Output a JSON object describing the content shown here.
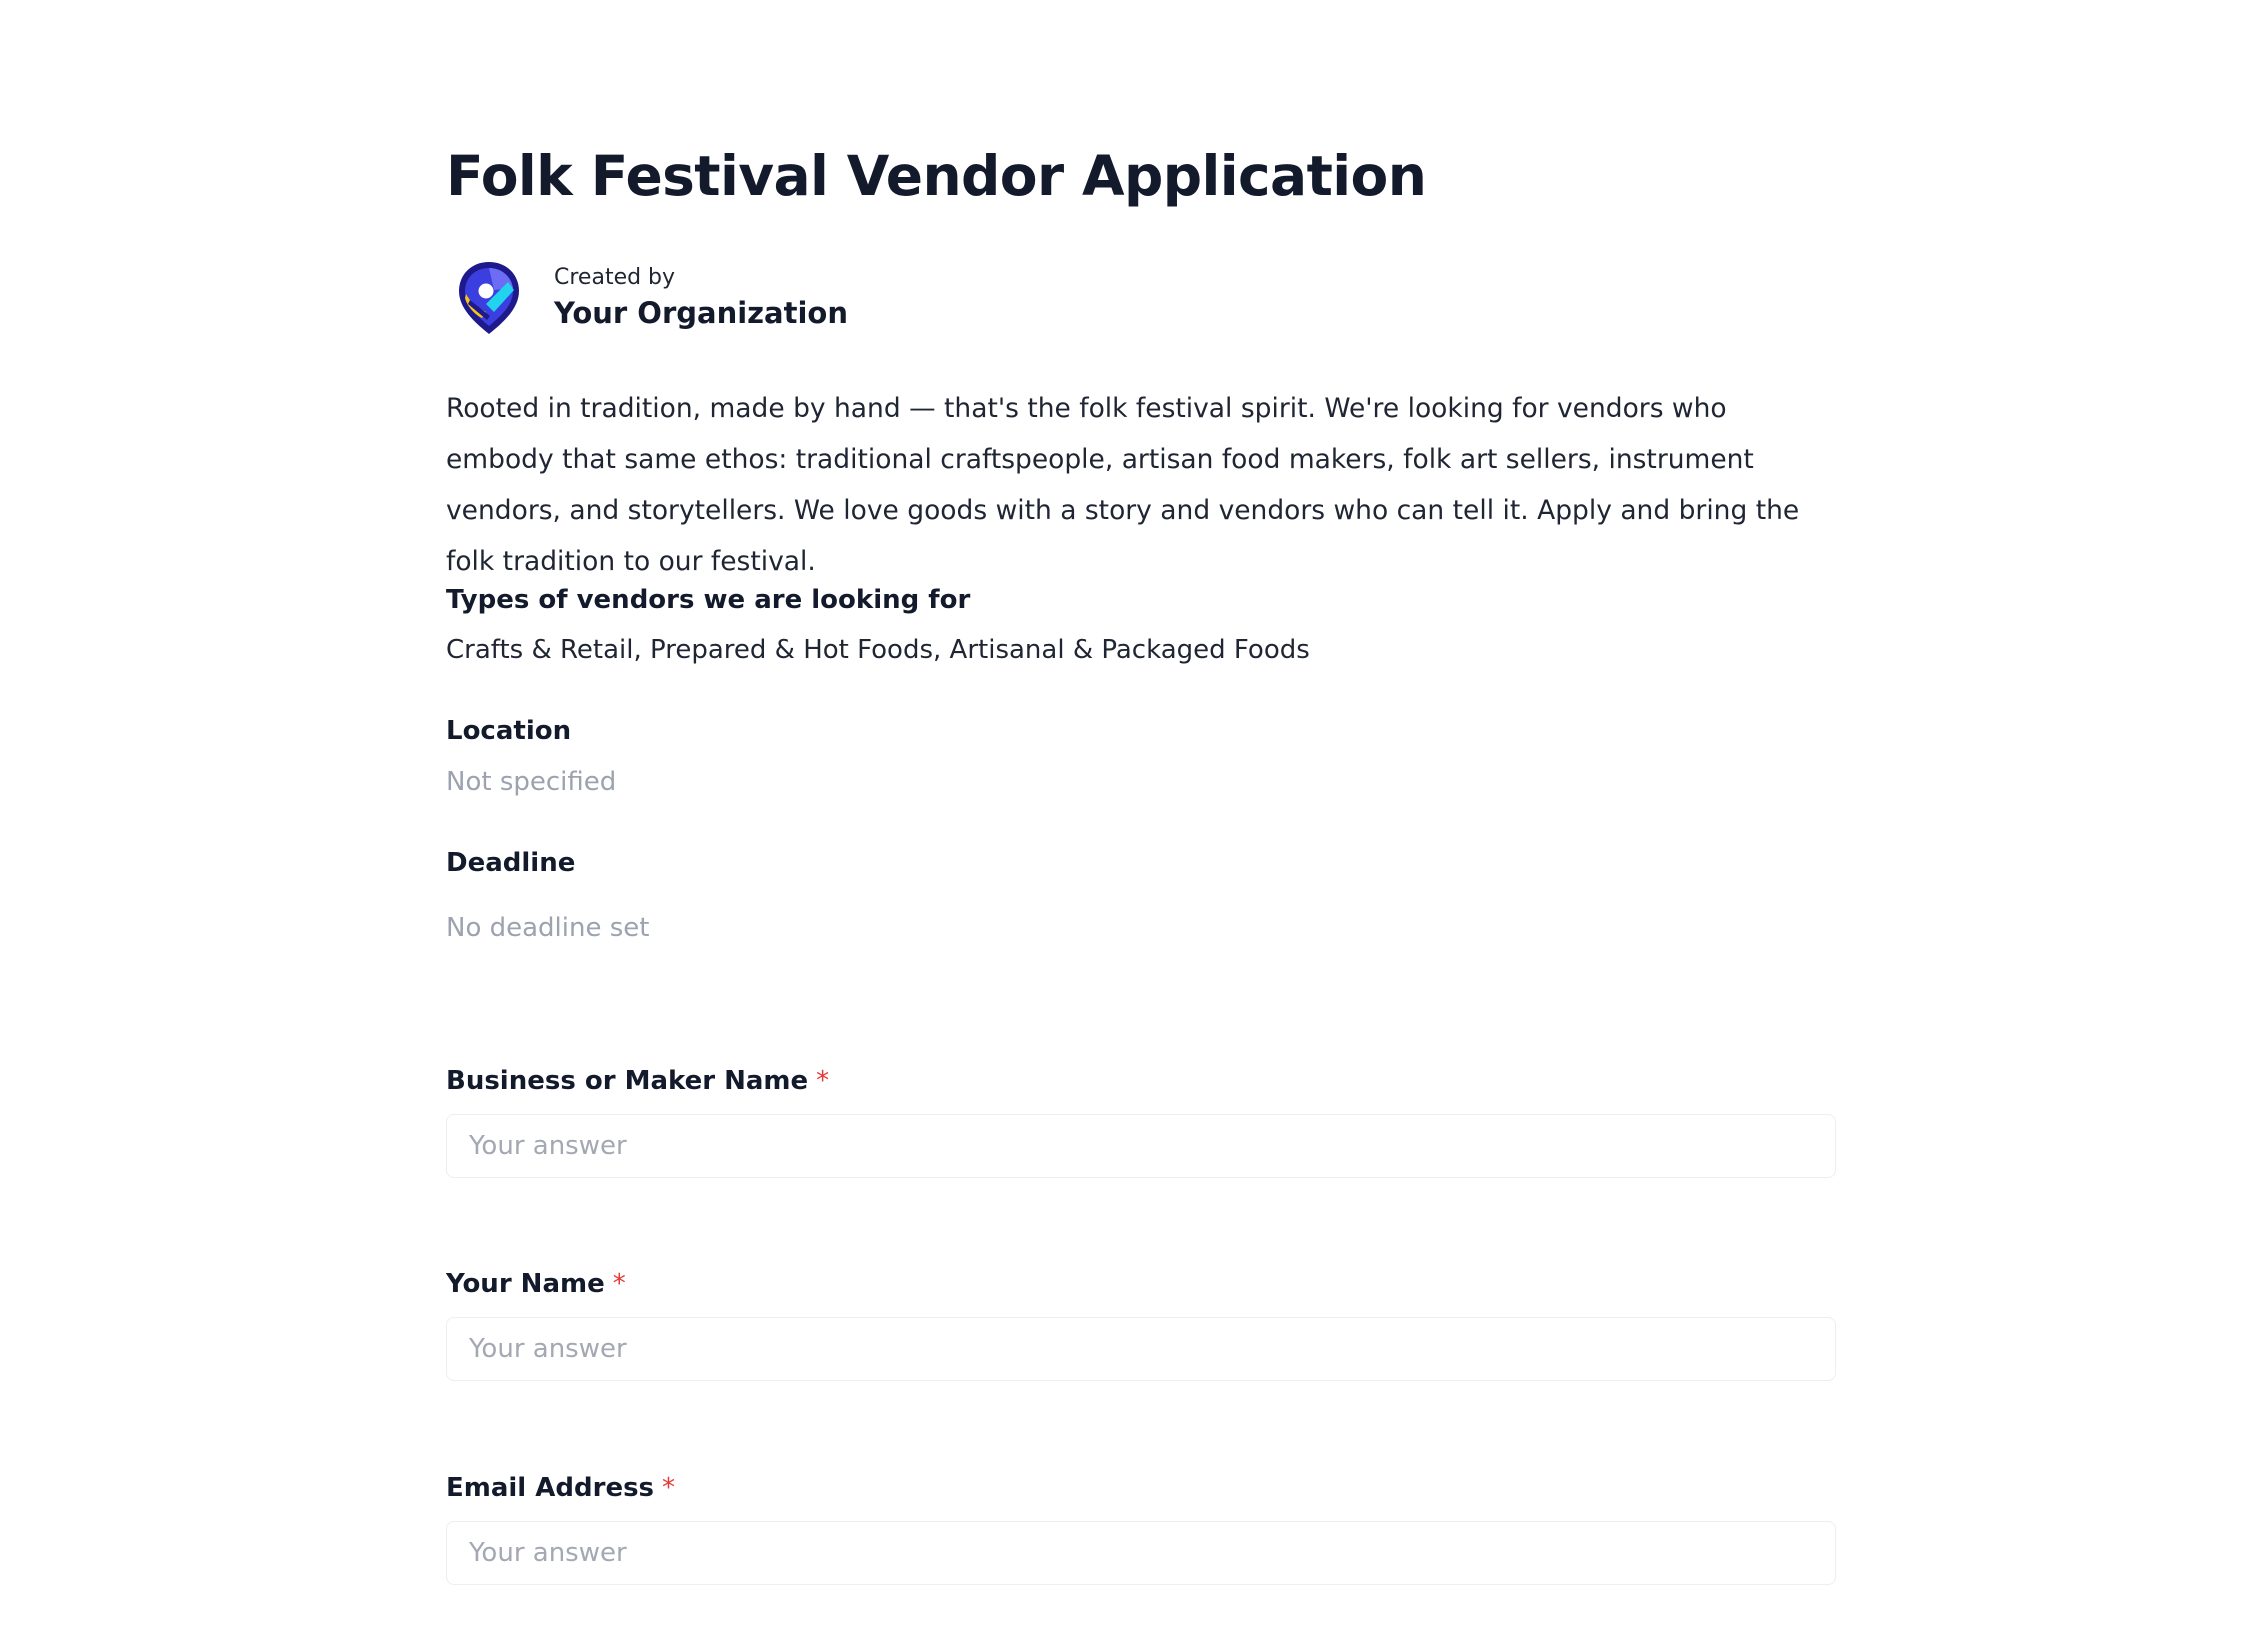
{
  "form": {
    "title": "Folk Festival Vendor Application",
    "creator": {
      "created_by_label": "Created by",
      "organization": "Your Organization",
      "logo_icon": "map-pin-logo-icon"
    },
    "description": "Rooted in tradition, made by hand — that's the folk festival spirit. We're looking for vendors who embody that same ethos: traditional craftspeople, artisan food makers, folk art sellers, instrument vendors, and storytellers. We love goods with a story and vendors who can tell it. Apply and bring the folk tradition to our festival.",
    "details": {
      "vendor_types_label": "Types of vendors we are looking for",
      "vendor_types_value": "Crafts & Retail, Prepared & Hot Foods, Artisanal & Packaged Foods",
      "location_label": "Location",
      "location_value": "Not specified",
      "deadline_label": "Deadline",
      "deadline_value": "No deadline set"
    },
    "fields": [
      {
        "label": "Business or Maker Name",
        "required_marker": "*",
        "placeholder": "Your answer",
        "value": ""
      },
      {
        "label": "Your Name",
        "required_marker": "*",
        "placeholder": "Your answer",
        "value": ""
      },
      {
        "label": "Email Address",
        "required_marker": "*",
        "placeholder": "Your answer",
        "value": ""
      }
    ]
  },
  "colors": {
    "title": "#131a2b",
    "muted_text": "#9ca3af",
    "required": "#e53935",
    "input_border": "#eceef2",
    "logo_navy": "#1e1a8c",
    "logo_blue": "#3b3fe0",
    "logo_cyan": "#22d3ee",
    "logo_yellow": "#f5c518"
  }
}
